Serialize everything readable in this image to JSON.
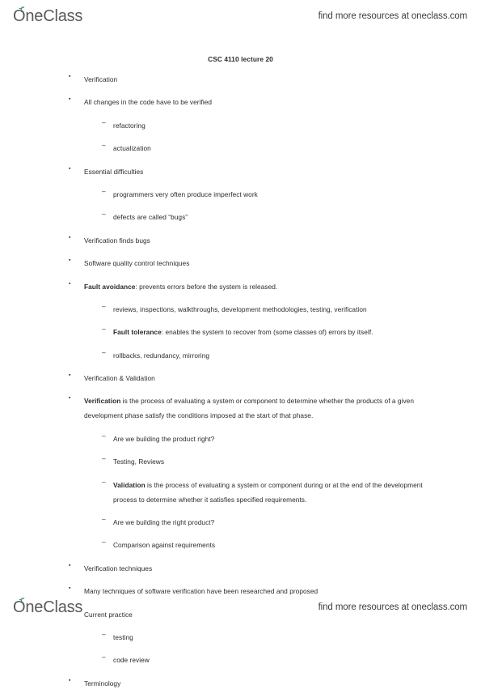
{
  "header": {
    "logo_text": "OneClass",
    "logo_icon": "leaf-sprout-icon",
    "promo_text": "find more resources at oneclass.com"
  },
  "footer": {
    "logo_text": "OneClass",
    "logo_icon": "leaf-sprout-icon",
    "promo_text": "find more resources at oneclass.com"
  },
  "document": {
    "title": "CSC 4110 lecture 20",
    "bullet_marker": "▪",
    "dash_marker": "–",
    "items": [
      {
        "level": 1,
        "text": "Verification"
      },
      {
        "level": 1,
        "text": "All changes in the code have to be verified"
      },
      {
        "level": 2,
        "text": "refactoring"
      },
      {
        "level": 2,
        "text": "actualization"
      },
      {
        "level": 1,
        "text": "Essential difficulties"
      },
      {
        "level": 2,
        "text": "programmers very often produce imperfect work"
      },
      {
        "level": 2,
        "text": "defects are called “bugs”"
      },
      {
        "level": 1,
        "text": "Verification finds bugs"
      },
      {
        "level": 1,
        "text": "Software quality control techniques"
      },
      {
        "level": 1,
        "bold": "Fault avoidance",
        "text": ": prevents errors before the system is released."
      },
      {
        "level": 2,
        "text": "reviews, inspections, walkthroughs, development methodologies, testing, verification"
      },
      {
        "level": 2,
        "bold": "Fault tolerance",
        "text": ": enables the system to recover from (some classes of) errors by itself."
      },
      {
        "level": 2,
        "text": "rollbacks, redundancy, mirroring"
      },
      {
        "level": 1,
        "text": "Verification & Validation"
      },
      {
        "level": 1,
        "bold": "Verification",
        "text": " is the process of evaluating a system or component to determine whether the products of a given development phase satisfy the conditions imposed at the start of that phase."
      },
      {
        "level": 2,
        "text": "Are we building the product right?"
      },
      {
        "level": 2,
        "text": "Testing, Reviews"
      },
      {
        "level": 2,
        "bold": "Validation",
        "text": " is the process of evaluating a system or component during or at the end of the development process to determine whether it satisfies specified requirements."
      },
      {
        "level": 2,
        "text": "Are we building the right product?"
      },
      {
        "level": 2,
        "text": "Comparison against requirements"
      },
      {
        "level": 1,
        "text": "Verification techniques"
      },
      {
        "level": 1,
        "text": "Many techniques of software verification have been researched and proposed"
      },
      {
        "level": 1,
        "text": "Current practice"
      },
      {
        "level": 2,
        "text": "testing"
      },
      {
        "level": 2,
        "text": "code review"
      },
      {
        "level": 1,
        "text": "Terminology"
      }
    ]
  },
  "colors": {
    "text": "#2b2b2b",
    "logo": "#5a5a5a",
    "accent_green": "#3d8b5f",
    "background": "#ffffff"
  }
}
